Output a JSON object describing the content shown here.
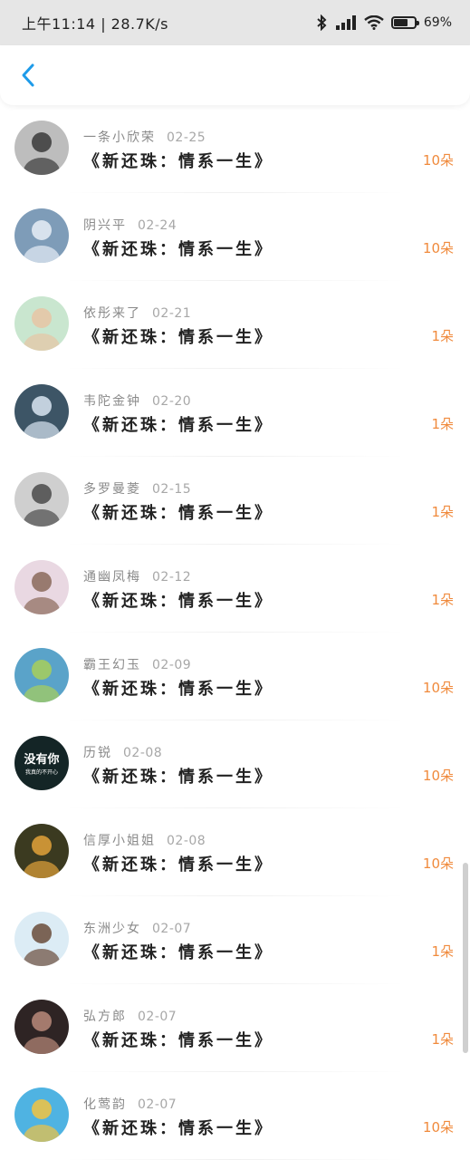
{
  "status_bar": {
    "time_speed": "上午11:14 | 28.7K/s",
    "battery": "69%",
    "battery_level": 0.69
  },
  "nav": {
    "back_icon": "chevron-left-icon",
    "accent": "#1e9be9"
  },
  "items": [
    {
      "name": "一条小欣荣",
      "date": "02-25",
      "title": "《新还珠：情系一生》",
      "amount": "10朵",
      "avatar": {
        "bg": "#bdbdbd",
        "fg": "#3a3a3a"
      }
    },
    {
      "name": "阴兴平",
      "date": "02-24",
      "title": "《新还珠：情系一生》",
      "amount": "10朵",
      "avatar": {
        "bg": "#7e9cb8",
        "fg": "#e7eef6"
      }
    },
    {
      "name": "依彤来了",
      "date": "02-21",
      "title": "《新还珠：情系一生》",
      "amount": "1朵",
      "avatar": {
        "bg": "#c9e6cf",
        "fg": "#e7c4a4"
      }
    },
    {
      "name": "韦陀金钟",
      "date": "02-20",
      "title": "《新还珠：情系一生》",
      "amount": "1朵",
      "avatar": {
        "bg": "#3d5566",
        "fg": "#d9e6f2"
      }
    },
    {
      "name": "多罗曼菱",
      "date": "02-15",
      "title": "《新还珠：情系一生》",
      "amount": "1朵",
      "avatar": {
        "bg": "#cfcfcf",
        "fg": "#4a4a4a"
      }
    },
    {
      "name": "通幽凤梅",
      "date": "02-12",
      "title": "《新还珠：情系一生》",
      "amount": "1朵",
      "avatar": {
        "bg": "#e9d8e2",
        "fg": "#8a6a5a"
      }
    },
    {
      "name": "霸王幻玉",
      "date": "02-09",
      "title": "《新还珠：情系一生》",
      "amount": "10朵",
      "avatar": {
        "bg": "#5aa3c9",
        "fg": "#a8cf5a"
      }
    },
    {
      "name": "历锐",
      "date": "02-08",
      "title": "《新还珠：情系一生》",
      "amount": "10朵",
      "avatar": {
        "bg": "#142526",
        "fg": "#ffffff",
        "text_main": "没有你",
        "text_sub": "我真的不开心"
      }
    },
    {
      "name": "信厚小姐姐",
      "date": "02-08",
      "title": "《新还珠：情系一生》",
      "amount": "10朵",
      "avatar": {
        "bg": "#3b3a20",
        "fg": "#e3a23a"
      }
    },
    {
      "name": "东洲少女",
      "date": "02-07",
      "title": "《新还珠：情系一生》",
      "amount": "1朵",
      "avatar": {
        "bg": "#dcecf5",
        "fg": "#6a4c3a"
      }
    },
    {
      "name": "弘方郎",
      "date": "02-07",
      "title": "《新还珠：情系一生》",
      "amount": "1朵",
      "avatar": {
        "bg": "#2e2424",
        "fg": "#b98a7a"
      }
    },
    {
      "name": "化莺韵",
      "date": "02-07",
      "title": "《新还珠：情系一生》",
      "amount": "10朵",
      "avatar": {
        "bg": "#4fb3e2",
        "fg": "#f2c341"
      }
    }
  ]
}
